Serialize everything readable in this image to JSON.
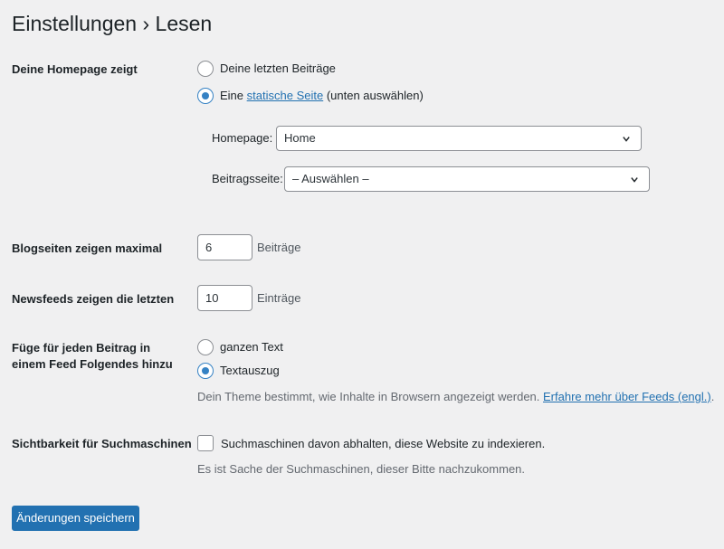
{
  "page": {
    "title": "Einstellungen › Lesen"
  },
  "homepage_display": {
    "label": "Deine Homepage zeigt",
    "option_latest": "Deine letzten Beiträge",
    "option_static_prefix": "Eine",
    "option_static_link": "statische Seite",
    "option_static_suffix": "(unten auswählen)",
    "selected": "static",
    "homepage_label": "Homepage:",
    "homepage_value": "Home",
    "posts_page_label": "Beitragsseite:",
    "posts_page_value": "– Auswählen –"
  },
  "blog_pages": {
    "label": "Blogseiten zeigen maximal",
    "value": "6",
    "unit": "Beiträge"
  },
  "feeds": {
    "label": "Newsfeeds zeigen die letzten",
    "value": "10",
    "unit": "Einträge"
  },
  "feed_content": {
    "label_line1": "Füge für jeden Beitrag in",
    "label_line2": "einem Feed Folgendes hinzu",
    "option_full": "ganzen Text",
    "option_excerpt": "Textauszug",
    "selected": "excerpt",
    "description": "Dein Theme bestimmt, wie Inhalte in Browsern angezeigt werden.",
    "learn_more_link": "Erfahre mehr über Feeds (engl.)",
    "learn_more_suffix": "."
  },
  "search_visibility": {
    "label": "Sichtbarkeit für Suchmaschinen",
    "checkbox_label": "Suchmaschinen davon abhalten, diese Website zu indexieren.",
    "checked": false,
    "description": "Es ist Sache der Suchmaschinen, dieser Bitte nachzukommen."
  },
  "actions": {
    "save_label": "Änderungen speichern"
  },
  "colors": {
    "primary": "#2271b1",
    "background": "#f0f0f1",
    "text": "#1d2327"
  },
  "icons": {
    "select_arrow": "chevron-down-icon"
  }
}
